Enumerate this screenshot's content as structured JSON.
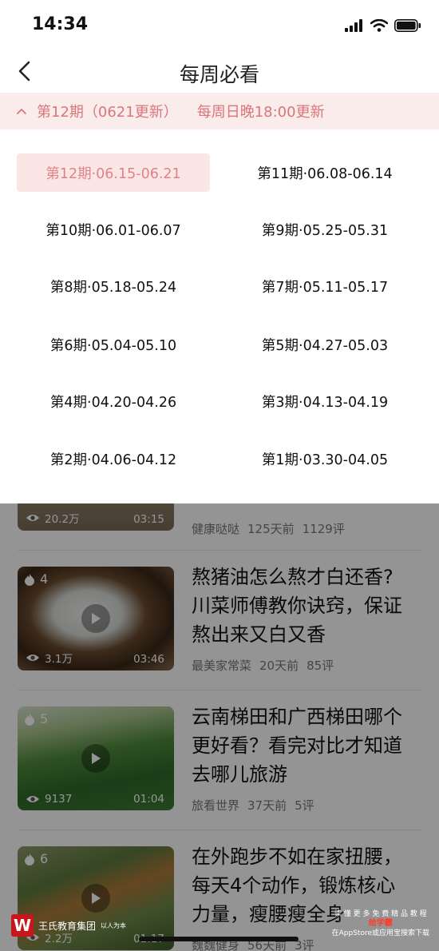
{
  "status_bar": {
    "time": "14:34"
  },
  "nav": {
    "title": "每周必看"
  },
  "issue_bar": {
    "current": "第12期（0621更新）",
    "schedule": "每周日晚18:00更新"
  },
  "periods": [
    "第12期·06.15-06.21",
    "第11期·06.08-06.14",
    "第10期·06.01-06.07",
    "第9期·05.25-05.31",
    "第8期·05.18-05.24",
    "第7期·05.11-05.17",
    "第6期·05.04-05.10",
    "第5期·04.27-05.03",
    "第4期·04.20-04.26",
    "第3期·04.13-04.19",
    "第2期·04.06-04.12",
    "第1期·03.30-04.05"
  ],
  "selected_period": "第12期·06.15-06.21",
  "items": [
    {
      "views": "20.2万",
      "duration": "03:15",
      "source": "健康哒哒",
      "time": "125天前",
      "comments": "1129评"
    },
    {
      "rank": "4",
      "title_lines": [
        "熬猪油怎么熬才白还香?",
        "川菜师傅教你诀窍，保证",
        "熬出来又白又香"
      ],
      "views": "3.1万",
      "duration": "03:46",
      "source": "最美家常菜",
      "time": "20天前",
      "comments": "85评"
    },
    {
      "rank": "5",
      "title_lines": [
        "云南梯田和广西梯田哪个",
        "更好看？看完对比才知道",
        "去哪儿旅游"
      ],
      "views": "9137",
      "duration": "01:04",
      "source": "旅看世界",
      "time": "37天前",
      "comments": "5评"
    },
    {
      "rank": "6",
      "title_lines": [
        "在外跑步不如在家扭腰，",
        "每天4个动作，锻炼核心",
        "力量，瘦腰瘦全身"
      ],
      "views": "2.2万",
      "duration": "01:17",
      "source": "魏魏健身",
      "time": "56天前",
      "comments": "3评"
    }
  ],
  "watermark": {
    "org": "王氏教育集团",
    "slogan": "以人为本",
    "right_line1": "读 懂 更 多 免 费 精 品 教 程",
    "right_brand": "给学霸",
    "right_line2": "在AppStore或应用宝搜索下载"
  },
  "colors": {
    "accent": "#e08287",
    "issue_bg": "#fbecec",
    "selected_bg": "#fbe6e6",
    "overlay": "rgba(0,0,0,0.42)"
  }
}
